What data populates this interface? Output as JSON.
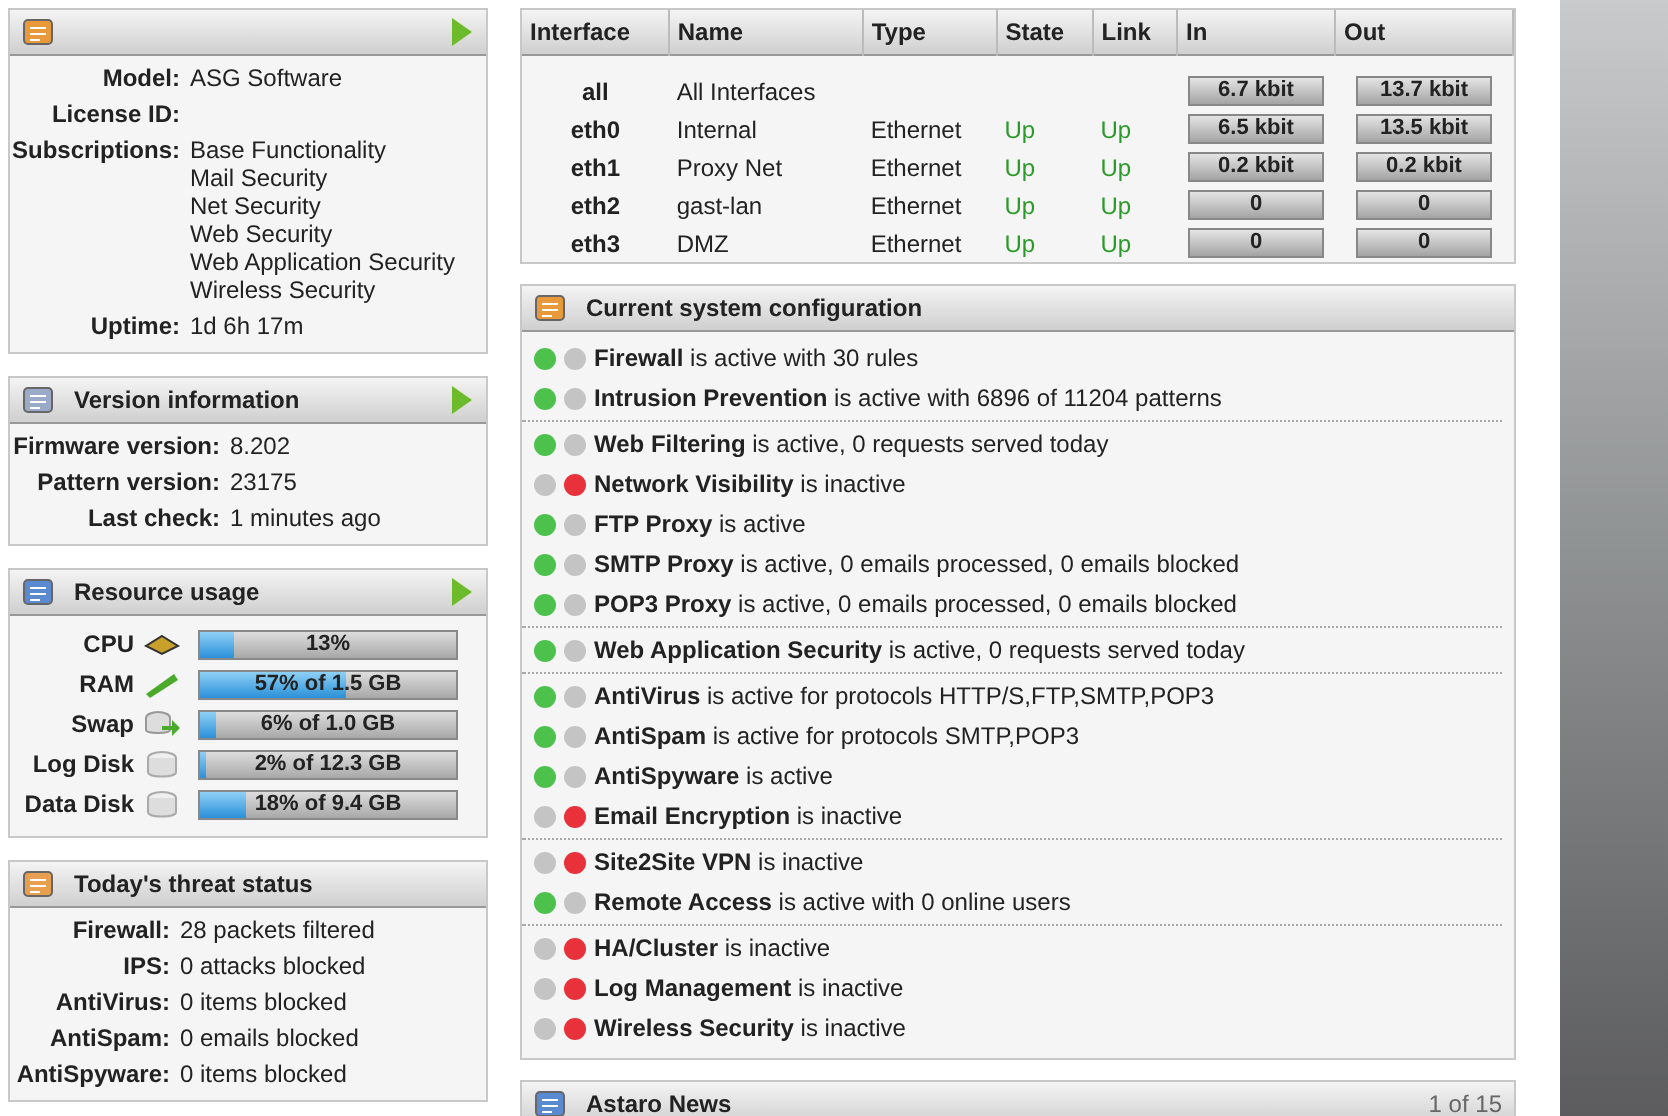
{
  "system_panel": {
    "rows": [
      {
        "label": "Model:",
        "values": [
          "ASG Software"
        ]
      },
      {
        "label": "License ID:",
        "values": []
      },
      {
        "label": "Subscriptions:",
        "values": [
          "Base Functionality",
          "Mail Security",
          "Net Security",
          "Web Security",
          "Web Application Security",
          "Wireless Security"
        ]
      },
      {
        "label": "Uptime:",
        "values": [
          "1d 6h 17m"
        ]
      }
    ]
  },
  "version_panel": {
    "title": "Version information",
    "rows": [
      {
        "label": "Firmware version:",
        "value": "8.202"
      },
      {
        "label": "Pattern version:",
        "value": "23175"
      },
      {
        "label": "Last check:",
        "value": "1 minutes ago"
      }
    ]
  },
  "resource_panel": {
    "title": "Resource usage",
    "meters": [
      {
        "kind": "cpu",
        "name": "CPU",
        "level": 0.13,
        "reading": "13%"
      },
      {
        "kind": "ram",
        "name": "RAM",
        "level": 0.57,
        "reading": "57% of 1.5 GB"
      },
      {
        "kind": "swap",
        "name": "Swap",
        "level": 0.06,
        "reading": "6% of 1.0 GB"
      },
      {
        "kind": "disk",
        "name": "Log Disk",
        "level": 0.02,
        "reading": "2% of 12.3 GB"
      },
      {
        "kind": "disk",
        "name": "Data Disk",
        "level": 0.18,
        "reading": "18% of 9.4 GB"
      }
    ]
  },
  "threat_panel": {
    "title": "Today's threat status",
    "rows": [
      {
        "label": "Firewall:",
        "value": "28 packets filtered"
      },
      {
        "label": "IPS:",
        "value": "0 attacks blocked"
      },
      {
        "label": "AntiVirus:",
        "value": "0 items blocked"
      },
      {
        "label": "AntiSpam:",
        "value": "0 emails blocked"
      },
      {
        "label": "AntiSpyware:",
        "value": "0 items blocked"
      }
    ]
  },
  "interfaces": {
    "columns": [
      "Interface",
      "Name",
      "Type",
      "State",
      "Link",
      "In",
      "Out"
    ],
    "rows": [
      {
        "interface": "all",
        "name": "All Interfaces",
        "in": "6.7 kbit",
        "out": "13.7 kbit"
      },
      {
        "interface": "eth0",
        "name": "Internal",
        "type": "Ethernet",
        "state": "Up",
        "link": "Up",
        "in": "6.5 kbit",
        "out": "13.5 kbit"
      },
      {
        "interface": "eth1",
        "name": "Proxy Net",
        "type": "Ethernet",
        "state": "Up",
        "link": "Up",
        "in": "0.2 kbit",
        "out": "0.2 kbit"
      },
      {
        "interface": "eth2",
        "name": "gast-lan",
        "type": "Ethernet",
        "state": "Up",
        "link": "Up",
        "in": "0",
        "out": "0"
      },
      {
        "interface": "eth3",
        "name": "DMZ",
        "type": "Ethernet",
        "state": "Up",
        "link": "Up",
        "in": "0",
        "out": "0"
      }
    ]
  },
  "config_panel": {
    "title": "Current system configuration",
    "groups": [
      [
        {
          "active": true,
          "text": "**Firewall** is active with 30 rules"
        },
        {
          "active": true,
          "text": "**Intrusion Prevention** is active with 6896 of 11204 patterns"
        }
      ],
      [
        {
          "active": true,
          "text": "**Web Filtering** is active, 0 requests served today"
        },
        {
          "active": false,
          "text": "**Network Visibility** is inactive"
        },
        {
          "active": true,
          "text": "**FTP Proxy** is active"
        },
        {
          "active": true,
          "text": "**SMTP Proxy** is active, 0 emails processed, 0 emails blocked"
        },
        {
          "active": true,
          "text": "**POP3 Proxy** is active, 0 emails processed, 0 emails blocked"
        }
      ],
      [
        {
          "active": true,
          "text": "**Web Application Security** is active, 0 requests served today"
        }
      ],
      [
        {
          "active": true,
          "text": "**AntiVirus** is active for protocols HTTP/S,FTP,SMTP,POP3"
        },
        {
          "active": true,
          "text": "**AntiSpam** is active for protocols SMTP,POP3"
        },
        {
          "active": true,
          "text": "**AntiSpyware** is active"
        },
        {
          "active": false,
          "text": "**Email Encryption** is inactive"
        }
      ],
      [
        {
          "active": false,
          "text": "**Site2Site VPN** is inactive"
        },
        {
          "active": true,
          "text": "**Remote Access** is active with 0 online users"
        }
      ],
      [
        {
          "active": false,
          "text": "**HA/Cluster** is inactive"
        },
        {
          "active": false,
          "text": "**Log Management** is inactive"
        },
        {
          "active": false,
          "text": "**Wireless Security** is inactive"
        }
      ]
    ]
  },
  "news_panel": {
    "title": "Astaro News",
    "pager": "1 of 15"
  }
}
